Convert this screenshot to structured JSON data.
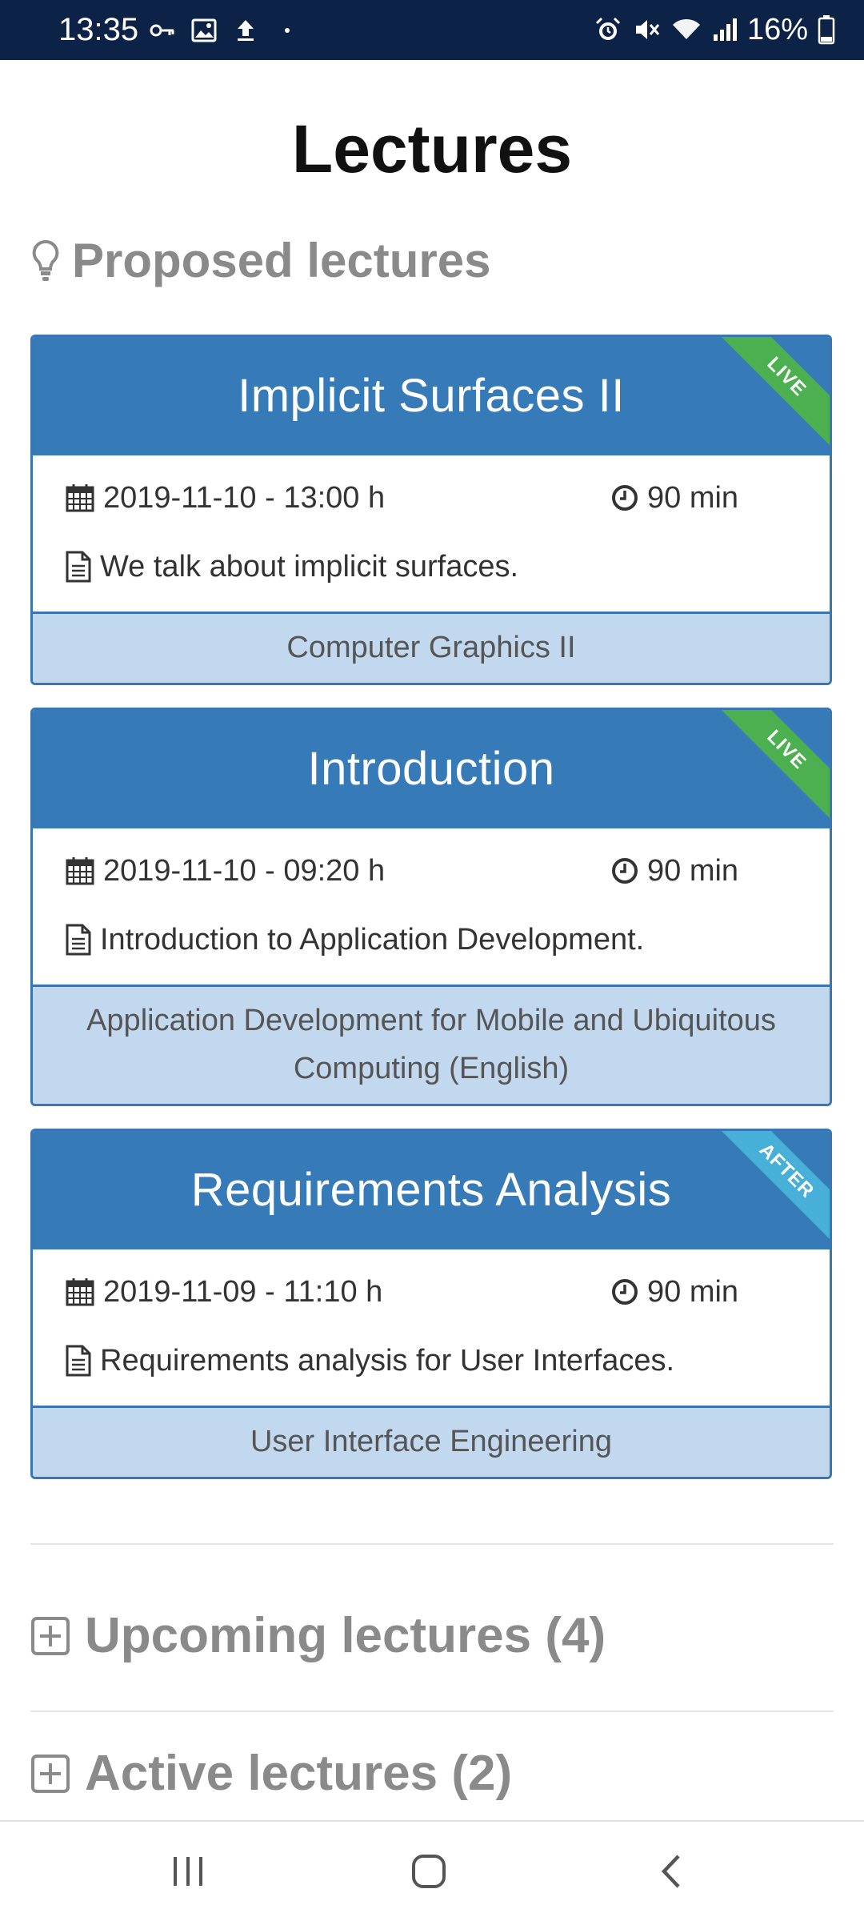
{
  "status_bar": {
    "time": "13:35",
    "battery": "16%",
    "left_icons": [
      "vpn-key-icon",
      "image-icon",
      "upload-icon",
      "dot-icon"
    ],
    "right_icons": [
      "alarm-icon",
      "mute-icon",
      "wifi-icon",
      "signal-icon",
      "battery-icon"
    ]
  },
  "page": {
    "title": "Lectures",
    "section_title": "Proposed lectures"
  },
  "lectures": [
    {
      "title": "Implicit Surfaces II",
      "badge": "LIVE",
      "date": "2019-11-10 - 13:00 h",
      "duration": "90 min",
      "description": "We talk about implicit surfaces.",
      "course": "Computer Graphics II"
    },
    {
      "title": "Introduction",
      "badge": "LIVE",
      "date": "2019-11-10 - 09:20 h",
      "duration": "90 min",
      "description": "Introduction to Application Development.",
      "course": "Application Development for Mobile and Ubiquitous Computing (English)"
    },
    {
      "title": "Requirements Analysis",
      "badge": "AFTER",
      "date": "2019-11-09 - 11:10 h",
      "duration": "90 min",
      "description": "Requirements analysis for User Interfaces.",
      "course": "User Interface Engineering"
    }
  ],
  "collapsibles": {
    "upcoming": "Upcoming lectures (4)",
    "active": "Active lectures (2)"
  },
  "colors": {
    "header_blue": "#367ab8",
    "footer_blue": "#c2d8ee",
    "live_green": "#4caf50",
    "after_cyan": "#47b0d8",
    "status_bar": "#0c2347"
  },
  "nav_icons": [
    "recent-apps-icon",
    "home-icon",
    "back-icon"
  ]
}
